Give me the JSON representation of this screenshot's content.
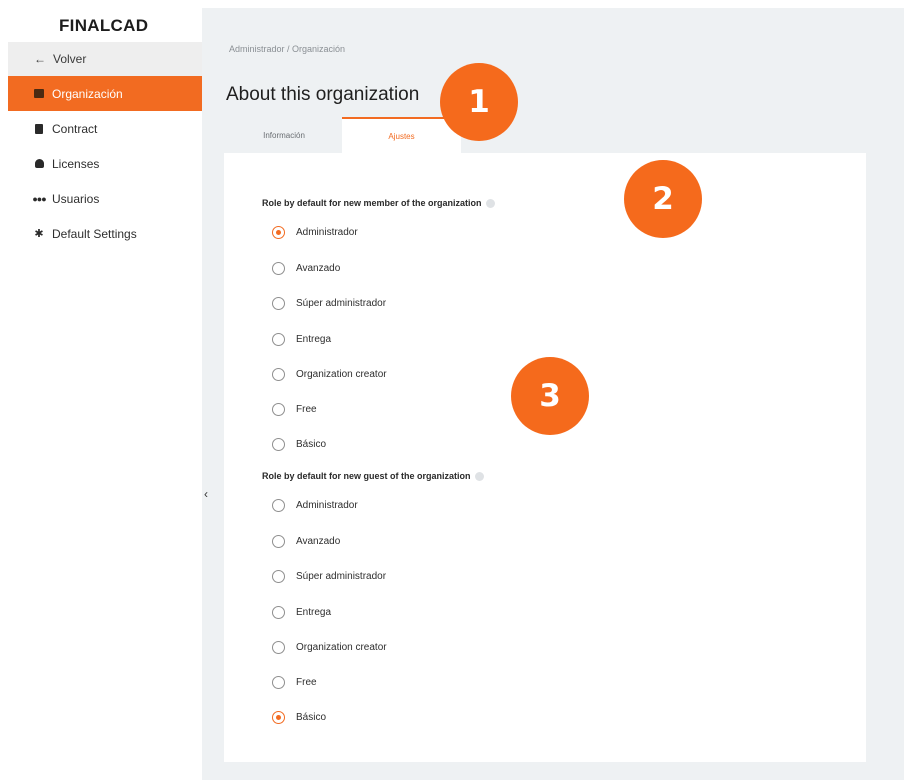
{
  "sidebar": {
    "logo": "FINALCAD",
    "back_label": "Volver",
    "items": [
      {
        "label": "Organización",
        "icon": "building-icon",
        "active": true
      },
      {
        "label": "Contract",
        "icon": "document-icon"
      },
      {
        "label": "Licenses",
        "icon": "person-icon"
      },
      {
        "label": "Usuarios",
        "icon": "users-icon"
      },
      {
        "label": "Default Settings",
        "icon": "gear-icon"
      }
    ]
  },
  "breadcrumb": "Administrador / Organización",
  "page_title": "About this organization",
  "tabs": [
    {
      "label": "Información",
      "active": false
    },
    {
      "label": "Ajustes",
      "active": true
    }
  ],
  "sections": [
    {
      "title": "Role by default for new member of the organization",
      "options": [
        "Administrador",
        "Avanzado",
        "Súper administrador",
        "Entrega",
        "Organization creator",
        "Free",
        "Básico"
      ],
      "selected": "Administrador"
    },
    {
      "title": "Role by default for new guest of the organization",
      "options": [
        "Administrador",
        "Avanzado",
        "Súper administrador",
        "Entrega",
        "Organization creator",
        "Free",
        "Básico"
      ],
      "selected": "Básico"
    }
  ],
  "badges": [
    "1",
    "2",
    "3"
  ],
  "colors": {
    "accent": "#f26b21",
    "badge": "#f56a1c",
    "background": "#eef1f3"
  }
}
